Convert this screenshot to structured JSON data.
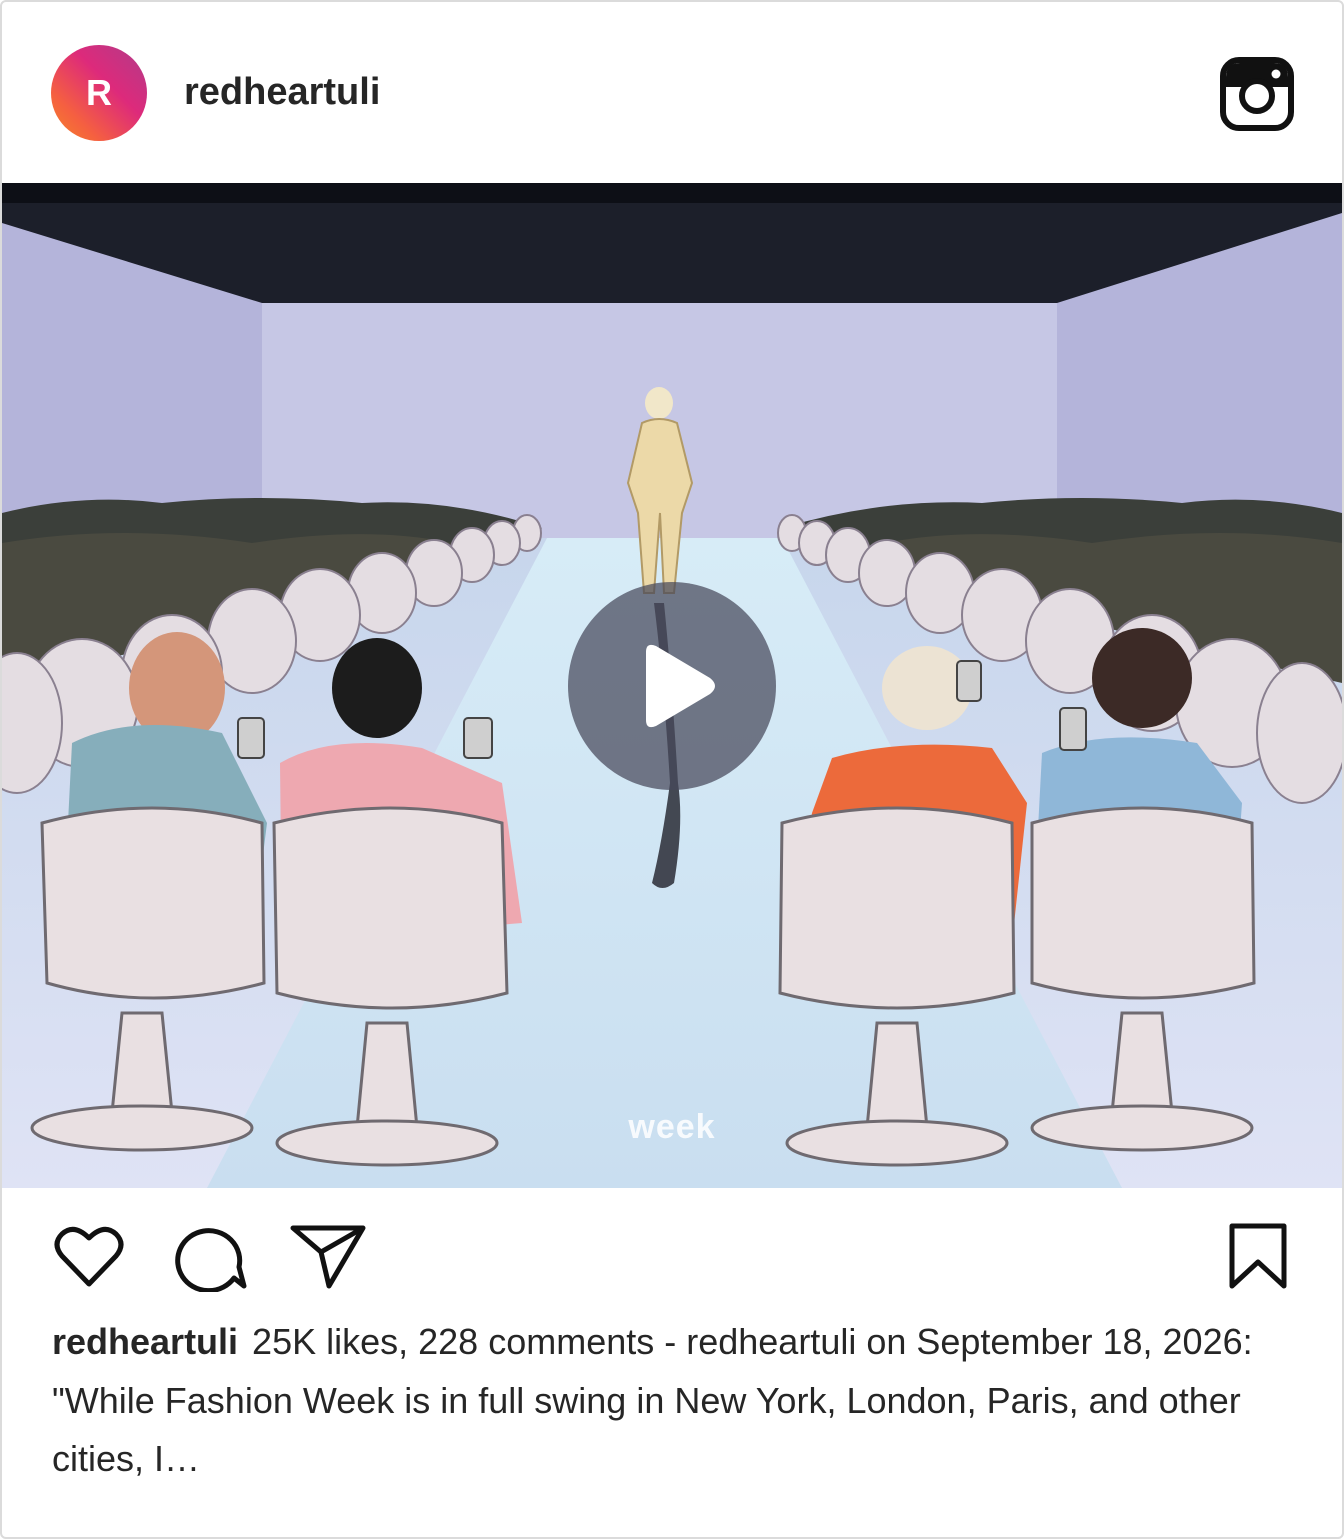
{
  "post": {
    "avatar_initial": "R",
    "username": "redheartuli",
    "media": {
      "overlay_text": "week",
      "play_icon": "play-icon"
    },
    "icons": {
      "brand": "instagram-icon",
      "like": "heart-icon",
      "comment": "comment-icon",
      "share": "send-icon",
      "save": "bookmark-icon"
    },
    "caption": {
      "username": "redheartuli",
      "text": "25K likes, 228 comments - redheartuli on September 18, 2026: \"While Fashion Week is in full swing in New York, London, Paris, and other cities, I…"
    },
    "colors": {
      "text": "#262626",
      "border": "#dbdbdb",
      "avatar_gradient_start": "#f58529",
      "avatar_gradient_end": "#b1288f"
    }
  }
}
